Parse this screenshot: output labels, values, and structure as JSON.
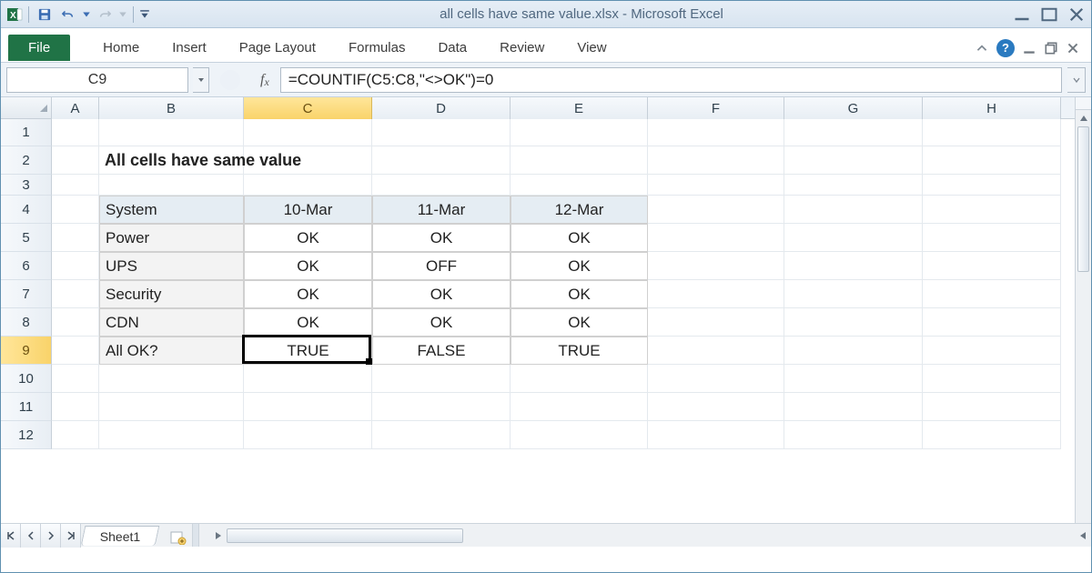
{
  "title": "all cells have same value.xlsx  -  Microsoft Excel",
  "ribbon": {
    "file": "File",
    "tabs": [
      "Home",
      "Insert",
      "Page Layout",
      "Formulas",
      "Data",
      "Review",
      "View"
    ]
  },
  "namebox": "C9",
  "formula": "=COUNTIF(C5:C8,\"<>OK\")=0",
  "columns": [
    "A",
    "B",
    "C",
    "D",
    "E",
    "F",
    "G",
    "H"
  ],
  "col_widths": {
    "A": 52,
    "B": 159,
    "C": 141,
    "D": 152,
    "E": 151,
    "F": 150,
    "G": 152,
    "H": 152
  },
  "selected_col": "C",
  "selected_row": 9,
  "row_heights": {
    "default": 31,
    "1": 30,
    "3": 23
  },
  "visible_rows": [
    1,
    2,
    3,
    4,
    5,
    6,
    7,
    8,
    9,
    10,
    11,
    12
  ],
  "heading": {
    "cell": "B2",
    "text": "All cells have same value"
  },
  "table": {
    "range": "B4:E9",
    "header": [
      "System",
      "10-Mar",
      "11-Mar",
      "12-Mar"
    ],
    "rows": [
      [
        "Power",
        "OK",
        "OK",
        "OK"
      ],
      [
        "UPS",
        "OK",
        "OFF",
        "OK"
      ],
      [
        "Security",
        "OK",
        "OK",
        "OK"
      ],
      [
        "CDN",
        "OK",
        "OK",
        "OK"
      ],
      [
        "All OK?",
        "TRUE",
        "FALSE",
        "TRUE"
      ]
    ]
  },
  "active_cell": "C9",
  "sheet_tabs": [
    "Sheet1"
  ],
  "colors": {
    "selected_header": "#f9d36a",
    "accent": "#207346"
  }
}
